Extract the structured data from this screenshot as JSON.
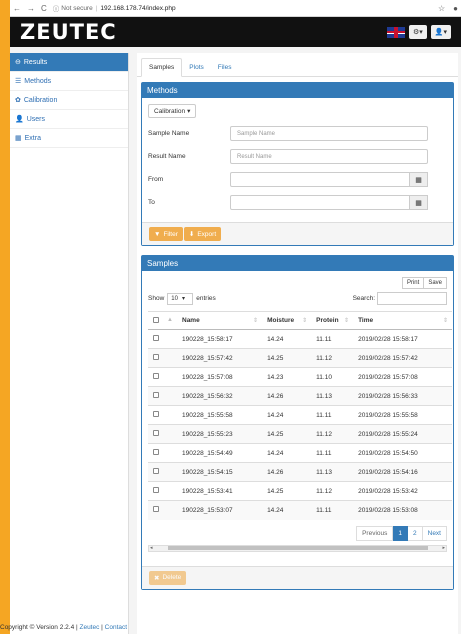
{
  "browser": {
    "secure_label": "Not secure",
    "url": "192.168.178.74/index.php"
  },
  "header": {
    "logo": "ZEUTEC",
    "settings_btn": "⚙▾",
    "user_btn": "👤▾"
  },
  "sidebar": {
    "items": [
      {
        "icon": "⊖",
        "label": "Results"
      },
      {
        "icon": "☰",
        "label": "Methods"
      },
      {
        "icon": "✿",
        "label": "Calibration"
      },
      {
        "icon": "👤",
        "label": "Users"
      },
      {
        "icon": "▦",
        "label": "Extra"
      }
    ]
  },
  "tabs": [
    "Samples",
    "Plots",
    "Files"
  ],
  "methods": {
    "title": "Methods",
    "calibration_label": "Calibration",
    "sample_name_label": "Sample Name",
    "sample_name_placeholder": "Sample Name",
    "result_name_label": "Result Name",
    "result_name_placeholder": "Result Name",
    "from_label": "From",
    "to_label": "To",
    "filter_label": "Filter",
    "export_label": "Export"
  },
  "samples": {
    "title": "Samples",
    "print_label": "Print",
    "save_label": "Save",
    "show_label": "Show",
    "entries_value": "10",
    "entries_label": "entries",
    "search_label": "Search:",
    "columns": [
      "Name",
      "Moisture",
      "Protein",
      "Time"
    ],
    "rows": [
      [
        "190228_15:58:17",
        "14.24",
        "11.11",
        "2019/02/28 15:58:17"
      ],
      [
        "190228_15:57:42",
        "14.25",
        "11.12",
        "2019/02/28 15:57:42"
      ],
      [
        "190228_15:57:08",
        "14.23",
        "11.10",
        "2019/02/28 15:57:08"
      ],
      [
        "190228_15:56:32",
        "14.26",
        "11.13",
        "2019/02/28 15:56:33"
      ],
      [
        "190228_15:55:58",
        "14.24",
        "11.11",
        "2019/02/28 15:55:58"
      ],
      [
        "190228_15:55:23",
        "14.25",
        "11.12",
        "2019/02/28 15:55:24"
      ],
      [
        "190228_15:54:49",
        "14.24",
        "11.11",
        "2019/02/28 15:54:50"
      ],
      [
        "190228_15:54:15",
        "14.26",
        "11.13",
        "2019/02/28 15:54:16"
      ],
      [
        "190228_15:53:41",
        "14.25",
        "11.12",
        "2019/02/28 15:53:42"
      ],
      [
        "190228_15:53:07",
        "14.24",
        "11.11",
        "2019/02/28 15:53:08"
      ]
    ],
    "pager": {
      "previous": "Previous",
      "page1": "1",
      "page2": "2",
      "next": "Next"
    },
    "delete_label": "Delete"
  },
  "footer": {
    "copyright": "Copyright ©",
    "version": "Version 2.2.4 |",
    "zeutec_link": "Zeutec",
    "contact_link": "Contact"
  }
}
